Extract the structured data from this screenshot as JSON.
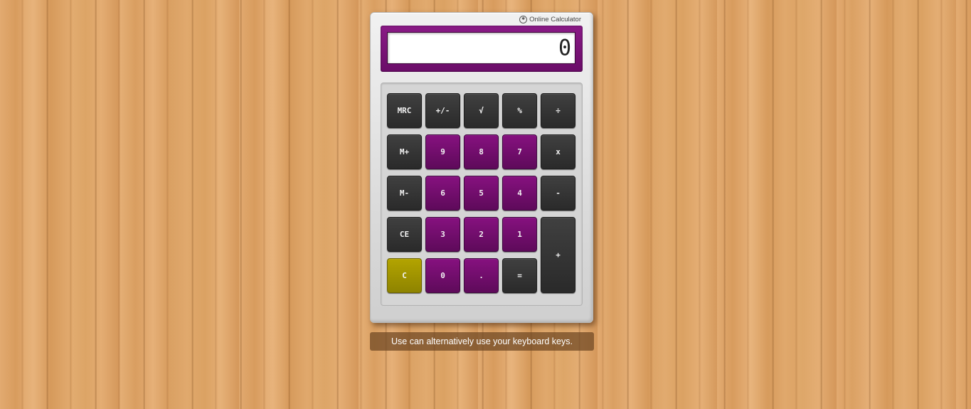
{
  "brand": {
    "icon": "calculator-logo-icon",
    "label": "Online Calculator"
  },
  "display": {
    "value": "0"
  },
  "keys": {
    "mrc": "MRC",
    "plus_minus": "+/-",
    "sqrt": "√",
    "percent": "%",
    "divide": "÷",
    "m_plus": "M+",
    "nine": "9",
    "eight": "8",
    "seven": "7",
    "multiply": "x",
    "m_minus": "M-",
    "six": "6",
    "five": "5",
    "four": "4",
    "subtract": "-",
    "ce": "CE",
    "three": "3",
    "two": "2",
    "one": "1",
    "add": "+",
    "clear": "C",
    "zero": "0",
    "decimal": ".",
    "equals": "="
  },
  "hint": {
    "text": "Use can alternatively use your keyboard keys."
  },
  "colors": {
    "display_frame": "#7a1377",
    "number_key": "#74106f",
    "operator_key": "#333333",
    "clear_key": "#a69800",
    "calculator_body": "#e2e2e2",
    "background_wood": "#dca066"
  }
}
